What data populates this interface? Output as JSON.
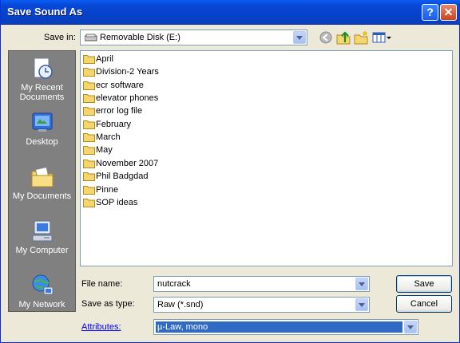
{
  "window": {
    "title": "Save Sound As"
  },
  "header": {
    "save_in_label": "Save in:",
    "save_in_value": "Removable Disk (E:)"
  },
  "places": [
    {
      "label": "My Recent Documents",
      "icon": "recent-documents-icon"
    },
    {
      "label": "Desktop",
      "icon": "desktop-icon"
    },
    {
      "label": "My Documents",
      "icon": "my-documents-icon"
    },
    {
      "label": "My Computer",
      "icon": "my-computer-icon"
    },
    {
      "label": "My Network",
      "icon": "my-network-icon"
    }
  ],
  "files": [
    "April",
    "Division-2 Years",
    "ecr software",
    "elevator phones",
    "error log file",
    "February",
    "March",
    "May",
    "November 2007",
    "Phil Badgdad",
    "Pinne",
    "SOP ideas"
  ],
  "form": {
    "filename_label": "File name:",
    "filename_value": "nutcrack",
    "type_label": "Save as type:",
    "type_value": "Raw (*.snd)",
    "attributes_label": "Attributes:",
    "attributes_value": "µ-Law, mono"
  },
  "buttons": {
    "save": "Save",
    "cancel": "Cancel"
  },
  "colors": {
    "titlebar": "#0a5ff5",
    "dialog_bg": "#ece9d8",
    "places_bg": "#808080",
    "selection": "#316ac5",
    "folder": "#f5d66e"
  }
}
